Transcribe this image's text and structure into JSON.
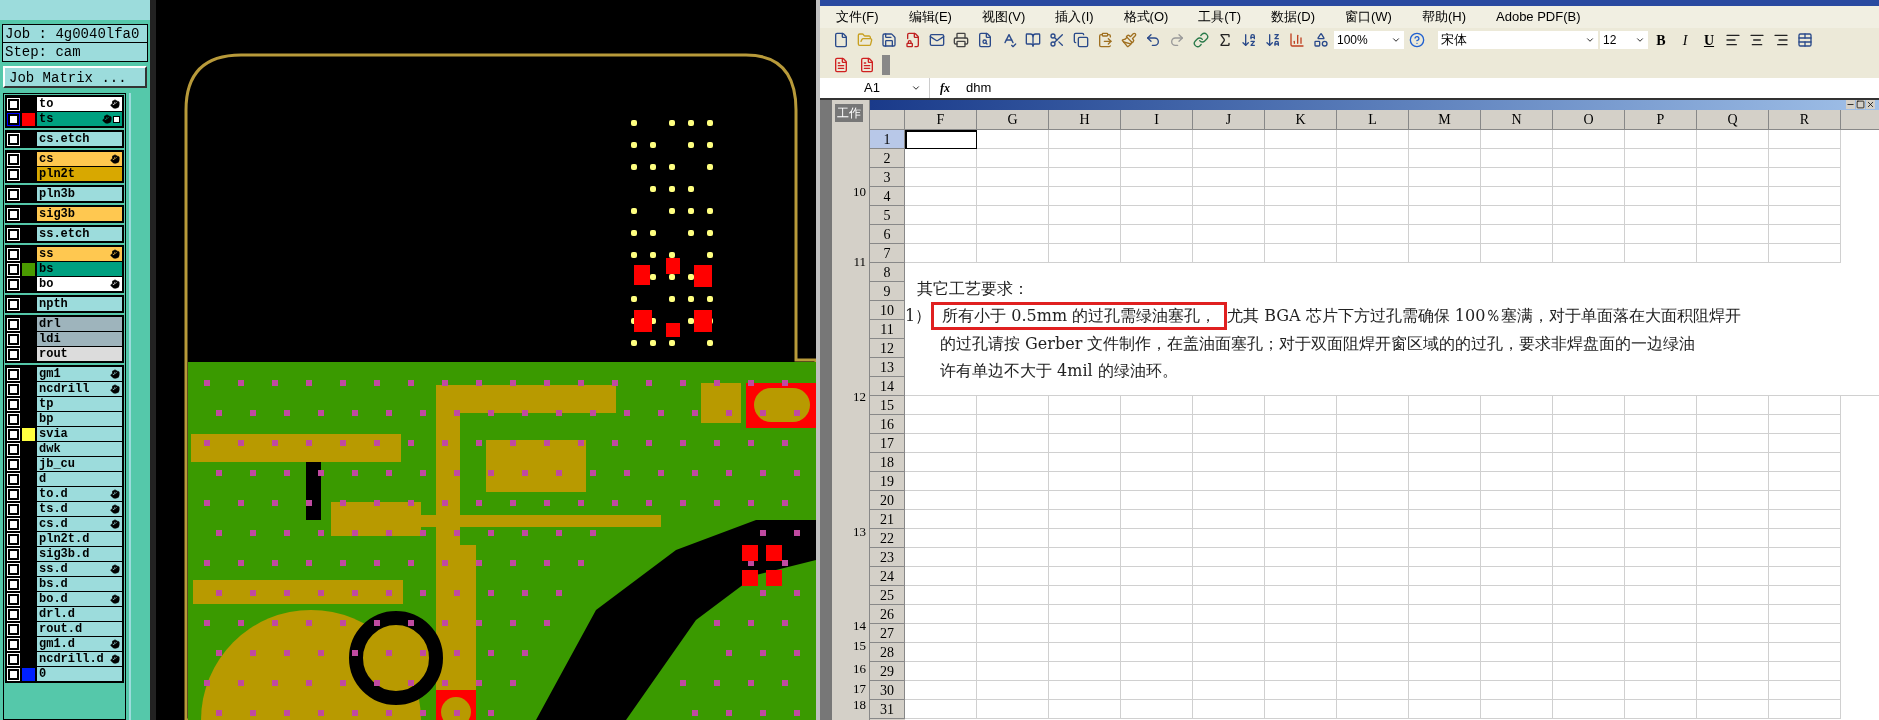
{
  "cam": {
    "job": "Job : 4g0040lfa0",
    "step": "Step: cam",
    "matrix_button": "Job Matrix ...",
    "layer_groups": [
      {
        "layers": [
          {
            "name": "to",
            "kind": "silk_screen",
            "affected": true,
            "work": false,
            "checked": false
          },
          {
            "name": "ts",
            "kind": "solder_mask",
            "color": "#ff0000",
            "affected": true,
            "work": true,
            "checked": false
          }
        ]
      },
      {
        "layers": [
          {
            "name": "cs.etch",
            "kind": "document",
            "affected": false,
            "work": false,
            "checked": false
          }
        ]
      },
      {
        "layers": [
          {
            "name": "cs",
            "kind": "signal",
            "affected": true,
            "work": false,
            "checked": false
          },
          {
            "name": "pln2t",
            "kind": "power_ground",
            "affected": false,
            "work": false,
            "checked": false
          }
        ]
      },
      {
        "layers": [
          {
            "name": "pln3b",
            "kind": "document",
            "affected": false,
            "work": false,
            "checked": false
          }
        ]
      },
      {
        "layers": [
          {
            "name": "sig3b",
            "kind": "signal",
            "affected": false,
            "work": false,
            "checked": false
          }
        ]
      },
      {
        "layers": [
          {
            "name": "ss.etch",
            "kind": "document",
            "affected": false,
            "work": false,
            "checked": false
          }
        ]
      },
      {
        "layers": [
          {
            "name": "ss",
            "kind": "signal",
            "affected": true,
            "work": false,
            "checked": false
          },
          {
            "name": "bs",
            "kind": "solder_mask",
            "color": "#4a9a00",
            "affected": false,
            "work": false,
            "checked": false
          },
          {
            "name": "bo",
            "kind": "silk_screen",
            "affected": true,
            "work": false,
            "checked": false
          }
        ]
      },
      {
        "layers": [
          {
            "name": "npth",
            "kind": "document",
            "affected": false,
            "work": false,
            "checked": false
          }
        ]
      },
      {
        "layers": [
          {
            "name": "drl",
            "kind": "drill",
            "affected": false,
            "work": false,
            "checked": false
          },
          {
            "name": "ldi",
            "kind": "drill",
            "affected": false,
            "work": false,
            "checked": false
          },
          {
            "name": "rout",
            "kind": "rout",
            "affected": false,
            "work": false,
            "checked": false
          }
        ]
      },
      {
        "layers": [
          {
            "name": "gm1",
            "kind": "document",
            "affected": true,
            "work": false,
            "checked": false
          },
          {
            "name": "ncdrill",
            "kind": "document",
            "affected": true,
            "work": false,
            "checked": false
          },
          {
            "name": "tp",
            "kind": "document",
            "affected": false,
            "work": false,
            "checked": false
          },
          {
            "name": "bp",
            "kind": "document",
            "affected": false,
            "work": false,
            "checked": false
          },
          {
            "name": "svia",
            "kind": "document",
            "color": "#ffff40",
            "affected": false,
            "work": false,
            "checked": false
          },
          {
            "name": "dwk",
            "kind": "document",
            "affected": false,
            "work": false,
            "checked": false
          },
          {
            "name": "jb_cu",
            "kind": "document",
            "affected": false,
            "work": false,
            "checked": false
          },
          {
            "name": "d",
            "kind": "document",
            "affected": false,
            "work": false,
            "checked": false
          },
          {
            "name": "to.d",
            "kind": "document",
            "affected": true,
            "work": false,
            "checked": false
          },
          {
            "name": "ts.d",
            "kind": "document",
            "affected": true,
            "work": false,
            "checked": false
          },
          {
            "name": "cs.d",
            "kind": "document",
            "affected": true,
            "work": false,
            "checked": false
          },
          {
            "name": "pln2t.d",
            "kind": "document",
            "affected": false,
            "work": false,
            "checked": false
          },
          {
            "name": "sig3b.d",
            "kind": "document",
            "affected": false,
            "work": false,
            "checked": false
          },
          {
            "name": "ss.d",
            "kind": "document",
            "affected": true,
            "work": false,
            "checked": false
          },
          {
            "name": "bs.d",
            "kind": "document",
            "affected": false,
            "work": false,
            "checked": false
          },
          {
            "name": "bo.d",
            "kind": "document",
            "affected": true,
            "work": false,
            "checked": false
          },
          {
            "name": "drl.d",
            "kind": "document",
            "affected": false,
            "work": false,
            "checked": false
          },
          {
            "name": "rout.d",
            "kind": "document",
            "affected": false,
            "work": false,
            "checked": false
          },
          {
            "name": "gm1.d",
            "kind": "document",
            "affected": true,
            "work": false,
            "checked": false
          },
          {
            "name": "ncdrill.d",
            "kind": "document",
            "affected": true,
            "work": false,
            "checked": false
          },
          {
            "name": "0",
            "kind": "document",
            "color": "#0020ff",
            "affected": false,
            "work": false,
            "checked": false
          }
        ]
      }
    ]
  },
  "excel": {
    "menu": [
      "文件(F)",
      "编辑(E)",
      "视图(V)",
      "插入(I)",
      "格式(O)",
      "工具(T)",
      "数据(D)",
      "窗口(W)",
      "帮助(H)",
      "Adobe PDF(B)"
    ],
    "zoom": "100%",
    "font": "宋体",
    "font_size": "12",
    "bold": "B",
    "italic": "I",
    "underline": "U",
    "name_box": "A1",
    "fx": "fx",
    "formula": "dhm",
    "back_sheet": {
      "tab": "工作",
      "row_labels": [
        "10",
        "11",
        "12",
        "13",
        "14",
        "15",
        "16",
        "17",
        "18"
      ]
    },
    "columns": [
      "F",
      "G",
      "H",
      "I",
      "J",
      "K",
      "L",
      "M",
      "N",
      "O",
      "P",
      "Q",
      "R"
    ],
    "rows": [
      {
        "label": "1",
        "selected": true
      },
      {
        "label": "2",
        "selected": false
      },
      {
        "label": "3",
        "selected": false
      },
      {
        "label": "4",
        "selected": false
      },
      {
        "label": "5",
        "selected": false
      },
      {
        "label": "6",
        "selected": false
      },
      {
        "label": "7",
        "selected": false
      },
      {
        "label": "8",
        "selected": false
      },
      {
        "label": "9",
        "selected": false
      },
      {
        "label": "10",
        "selected": false
      },
      {
        "label": "11",
        "selected": false
      },
      {
        "label": "12",
        "selected": false
      },
      {
        "label": "13",
        "selected": false
      },
      {
        "label": "14",
        "selected": false
      },
      {
        "label": "15",
        "selected": false
      },
      {
        "label": "16",
        "selected": false
      },
      {
        "label": "17",
        "selected": false
      },
      {
        "label": "18",
        "selected": false
      },
      {
        "label": "19",
        "selected": false
      },
      {
        "label": "20",
        "selected": false
      },
      {
        "label": "21",
        "selected": false
      },
      {
        "label": "22",
        "selected": false
      },
      {
        "label": "23",
        "selected": false
      },
      {
        "label": "24",
        "selected": false
      },
      {
        "label": "25",
        "selected": false
      },
      {
        "label": "26",
        "selected": false
      },
      {
        "label": "27",
        "selected": false
      },
      {
        "label": "28",
        "selected": false
      },
      {
        "label": "29",
        "selected": false
      },
      {
        "label": "30",
        "selected": false
      },
      {
        "label": "31",
        "selected": false
      }
    ],
    "note": {
      "heading": "其它工艺要求：",
      "item_number": "1）",
      "highlighted": "所有小于 0.5mm 的过孔需绿油塞孔，",
      "lines": [
        "尤其 BGA 芯片下方过孔需确保 100％塞满，对于单面落在大面积阻焊开",
        "的过孔请按 Gerber 文件制作，在盖油面塞孔；对于双面阻焊开窗区域的的过孔，要求非焊盘面的一边绿油",
        "许有单边不大于 4mil 的绿油环。"
      ]
    }
  }
}
